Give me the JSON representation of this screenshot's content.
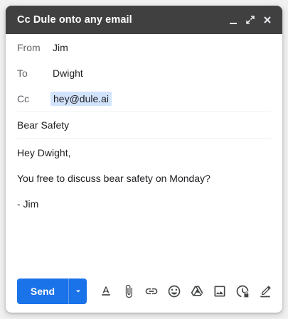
{
  "window": {
    "title": "Cc Dule onto any email"
  },
  "fields": {
    "from_label": "From",
    "from_value": "Jim",
    "to_label": "To",
    "to_value": "Dwight",
    "cc_label": "Cc",
    "cc_value": "hey@dule.ai"
  },
  "subject": "Bear Safety",
  "body": {
    "greeting": "Hey Dwight,",
    "line1": "You free to discuss bear safety on Monday?",
    "signature": "- Jim"
  },
  "toolbar": {
    "send_label": "Send",
    "icons": [
      "format-text-icon",
      "attach-icon",
      "link-icon",
      "emoji-icon",
      "drive-icon",
      "photo-icon",
      "confidential-icon",
      "signature-icon"
    ]
  },
  "colors": {
    "titlebar": "#404040",
    "send": "#1a73e8",
    "chip": "#d2e3fc"
  }
}
